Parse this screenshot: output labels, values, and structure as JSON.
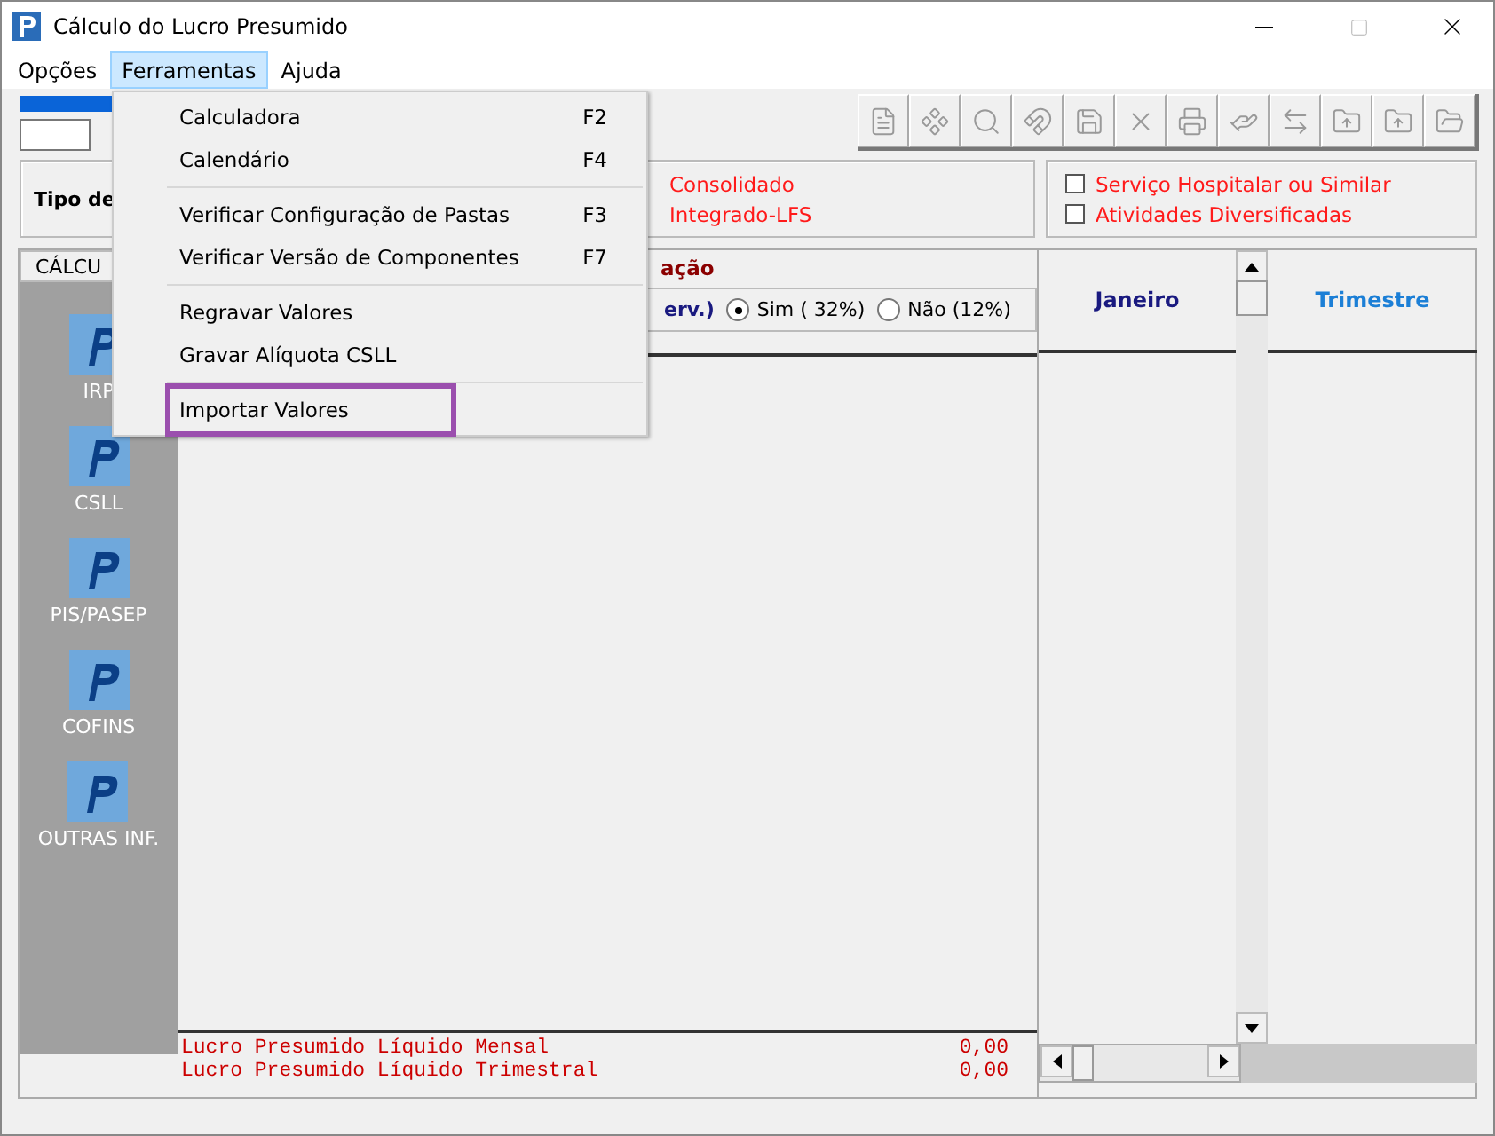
{
  "window": {
    "title": "Cálculo do Lucro Presumido"
  },
  "menu_bar": [
    {
      "label": "Opções",
      "selected": false
    },
    {
      "label": "Ferramentas",
      "selected": true
    },
    {
      "label": "Ajuda",
      "selected": false
    }
  ],
  "dropdown": {
    "groups": [
      [
        {
          "label": "Calculadora",
          "shortcut": "F2",
          "highlighted": false
        },
        {
          "label": "Calendário",
          "shortcut": "F4",
          "highlighted": false
        }
      ],
      [
        {
          "label": "Verificar Configuração de Pastas",
          "shortcut": "F3",
          "highlighted": false
        },
        {
          "label": "Verificar Versão de Componentes",
          "shortcut": "F7",
          "highlighted": false
        }
      ],
      [
        {
          "label": "Regravar Valores",
          "highlighted": false
        },
        {
          "label": "Gravar Alíquota CSLL",
          "highlighted": false
        }
      ],
      [
        {
          "label": "Importar Valores",
          "highlighted": true
        }
      ]
    ]
  },
  "type_label": "Tipo de",
  "type_options": [
    {
      "label": "Consolidado"
    },
    {
      "label": "Integrado-LFS"
    }
  ],
  "checkboxes": [
    {
      "label": "Serviço Hospitalar ou Similar",
      "checked": false
    },
    {
      "label": "Atividades Diversificadas",
      "checked": false
    }
  ],
  "sidebar": {
    "tab": "CÁLCU",
    "items": [
      {
        "label": "IRP"
      },
      {
        "label": "CSLL"
      },
      {
        "label": "PIS/PASEP"
      },
      {
        "label": "COFINS"
      },
      {
        "label": "OUTRAS INF."
      }
    ]
  },
  "section_title": "ação",
  "question": "erv.)",
  "radios": [
    {
      "label": "Sim ( 32%)",
      "selected": true
    },
    {
      "label": "Não (12%)",
      "selected": false
    }
  ],
  "columns": [
    "Janeiro",
    "Trimestre"
  ],
  "totals": [
    {
      "label": "Lucro Presumido Líquido Mensal",
      "value": "0,00"
    },
    {
      "label": "Lucro Presumido Líquido Trimestral",
      "value": "0,00"
    }
  ]
}
